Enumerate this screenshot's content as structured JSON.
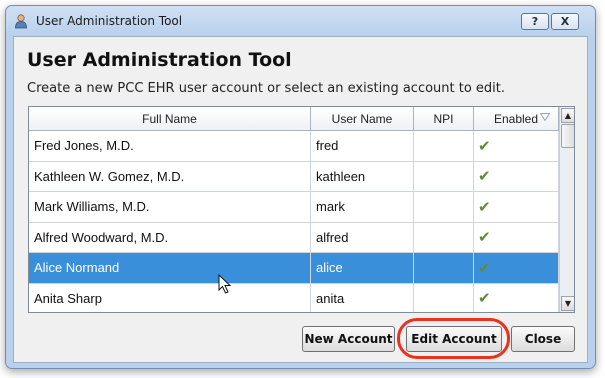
{
  "window": {
    "title": "User Administration Tool",
    "help_label": "?",
    "close_label": "X"
  },
  "dialog": {
    "heading": "User Administration Tool",
    "subtitle": "Create a new PCC EHR user account or select an existing account to edit."
  },
  "table": {
    "columns": [
      "Full Name",
      "User Name",
      "NPI",
      "Enabled"
    ],
    "rows": [
      {
        "full_name": "Fred Jones, M.D.",
        "user_name": "fred",
        "npi": "",
        "enabled": true
      },
      {
        "full_name": "Kathleen W. Gomez, M.D.",
        "user_name": "kathleen",
        "npi": "",
        "enabled": true
      },
      {
        "full_name": "Mark Williams, M.D.",
        "user_name": "mark",
        "npi": "",
        "enabled": true
      },
      {
        "full_name": "Alfred Woodward, M.D.",
        "user_name": "alfred",
        "npi": "",
        "enabled": true
      },
      {
        "full_name": "Alice Normand",
        "user_name": "alice",
        "npi": "",
        "enabled": true,
        "selected": true
      },
      {
        "full_name": "Anita Sharp",
        "user_name": "anita",
        "npi": "",
        "enabled": true
      }
    ],
    "checkmark": "✔",
    "selected_row_color": "#3a8fdb",
    "check_color": "#5f8a3a"
  },
  "buttons": {
    "new_account": "New Account",
    "edit_account": "Edit Account",
    "close": "Close"
  },
  "accent": {
    "highlight_ring": "#e8321f"
  }
}
